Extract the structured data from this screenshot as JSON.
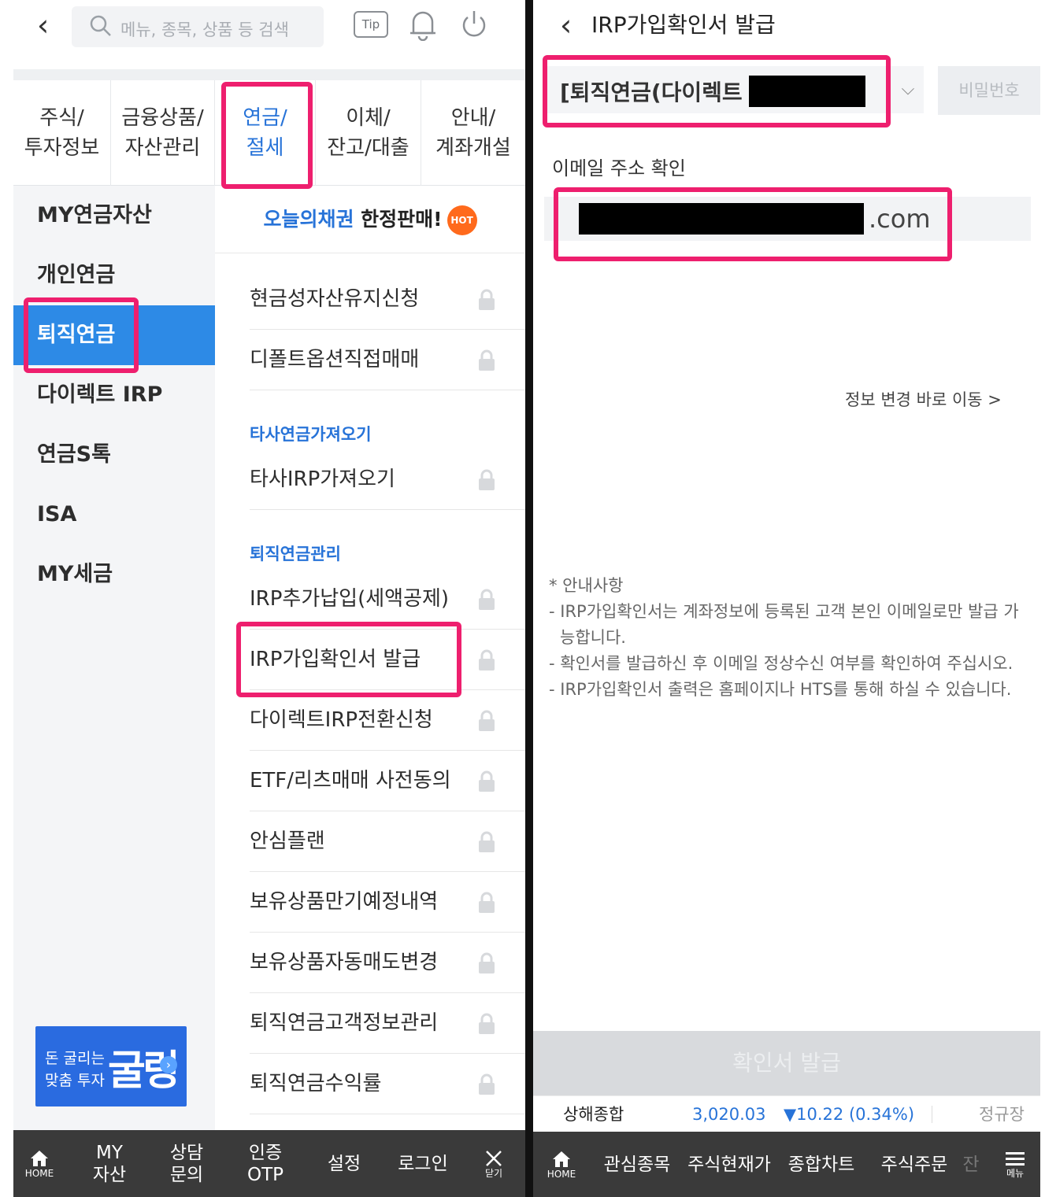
{
  "left": {
    "search_placeholder": "메뉴, 종목, 상품 등 검색",
    "tip_label": "Tip",
    "tabs": [
      {
        "line1": "주식/",
        "line2": "투자정보"
      },
      {
        "line1": "금융상품/",
        "line2": "자산관리"
      },
      {
        "line1": "연금/",
        "line2": "절세"
      },
      {
        "line1": "이체/",
        "line2": "잔고/대출"
      },
      {
        "line1": "안내/",
        "line2": "계좌개설"
      }
    ],
    "left_nav": [
      "MY연금자산",
      "개인연금",
      "퇴직연금",
      "다이렉트 IRP",
      "연금S톡",
      "ISA",
      "MY세금"
    ],
    "banner": {
      "part1": "오늘의채권",
      "part2": " 한정판매!",
      "badge": "HOT"
    },
    "items_a": [
      "현금성자산유지신청",
      "디폴트옵션직접매매"
    ],
    "section1": "타사연금가져오기",
    "items_b": [
      "타사IRP가져오기"
    ],
    "section2": "퇴직연금관리",
    "items_c": [
      "IRP추가납입(세액공제)",
      "IRP가입확인서 발급",
      "다이렉트IRP전환신청",
      "ETF/리츠매매 사전동의",
      "안심플랜",
      "보유상품만기예정내역",
      "보유상품자동매도변경",
      "퇴직연금고객정보관리",
      "퇴직연금수익률"
    ],
    "promo": {
      "line1": "돈 굴리는",
      "line2": "맞춤 투자",
      "big": "굴링",
      "arrow": "›"
    },
    "bottom": {
      "home": "HOME",
      "my1": "MY",
      "my2": "자산",
      "cs1": "상담",
      "cs2": "문의",
      "otp1": "인증",
      "otp2": "OTP",
      "settings": "설정",
      "login": "로그인",
      "close": "닫기"
    }
  },
  "right": {
    "title": "IRP가입확인서 발급",
    "account_text": "[퇴직연금(다이렉트",
    "password_placeholder": "비밀번호",
    "email_label": "이메일 주소 확인",
    "email_domain": ".com",
    "info_link": "정보 변경 바로 이동 >",
    "notice_title": "* 안내사항",
    "notices": [
      "- IRP가입확인서는 계좌정보에 등록된 고객 본인 이메일로만 발급 가능합니다.",
      "- 확인서를 발급하신 후 이메일 정상수신 여부를 확인하여 주십시오.",
      "- IRP가입확인서 출력은 홈페이지나 HTS를 통해 하실 수 있습니다."
    ],
    "issue_button": "확인서 발급",
    "ticker": {
      "name": "상해종합",
      "value": "3,020.03",
      "change": "▼10.22 (0.34%)",
      "session": "정규장"
    },
    "bottom": {
      "home": "HOME",
      "watch": "관심종목",
      "price": "주식현재가",
      "chart": "종합차트",
      "order": "주식주문",
      "more": "잔",
      "menu": "메뉴"
    }
  },
  "colors": {
    "accent_blue": "#2773d8",
    "highlight_pink": "#ee1f6e",
    "selected_nav": "#2d8ae6",
    "bottom_bar": "#3a3a3a"
  }
}
